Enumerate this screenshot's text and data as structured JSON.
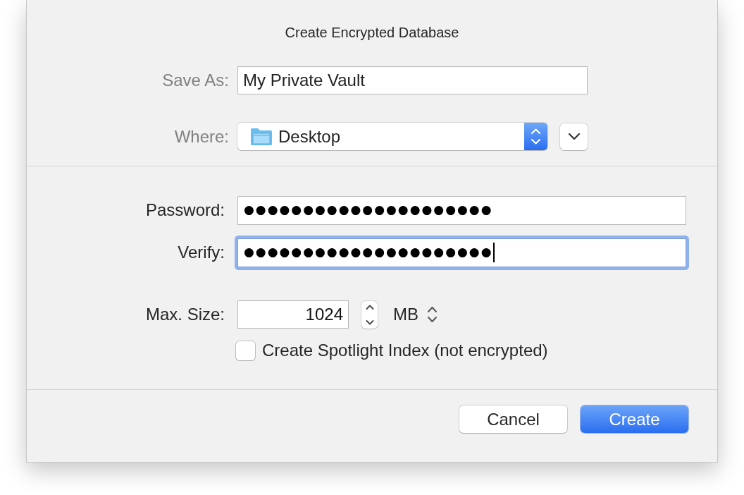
{
  "dialog": {
    "title": "Create Encrypted Database"
  },
  "save_as": {
    "label": "Save As:",
    "value": "My Private Vault"
  },
  "where": {
    "label": "Where:",
    "value": "Desktop",
    "expanded": false
  },
  "password_fields": [
    {
      "label": "Password:",
      "value": "●●●●●●●●●●●●●●●●●●●●●",
      "focused": false
    },
    {
      "label": "Verify:",
      "value": "●●●●●●●●●●●●●●●●●●●●●",
      "focused": true
    }
  ],
  "max_size": {
    "label": "Max. Size:",
    "value": "1024",
    "unit": "MB"
  },
  "spotlight": {
    "label": "Create Spotlight Index (not encrypted)",
    "checked": false
  },
  "buttons": [
    {
      "label": "Cancel",
      "default": false
    },
    {
      "label": "Create",
      "default": true
    }
  ]
}
